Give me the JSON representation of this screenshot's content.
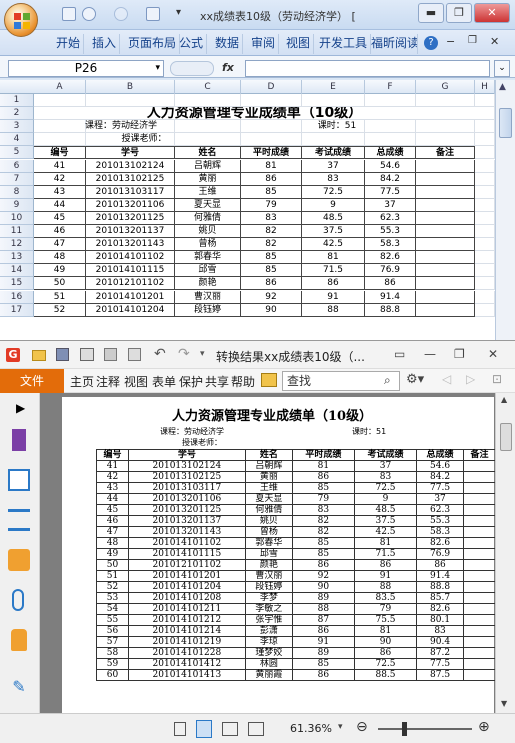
{
  "excel": {
    "title": "xx成绩表10级（劳动经济学）  [",
    "window_buttons": [
      "▬",
      "❐",
      "✕"
    ],
    "ribbon_tabs": [
      "开始",
      "插入",
      "页面布局",
      "公式",
      "数据",
      "审阅",
      "视图",
      "开发工具",
      "福昕阅读器"
    ],
    "name_box": "P26",
    "fx_label": "fx",
    "columns": [
      "A",
      "B",
      "C",
      "D",
      "E",
      "F",
      "G",
      "H"
    ],
    "sheet": {
      "title": "人力资源管理专业成绩单（10级）",
      "course_label": "课程：劳动经济学",
      "hours_label": "课时：51",
      "teacher_label": "授课老师：",
      "headers": [
        "编号",
        "学号",
        "姓名",
        "平时成绩",
        "考试成绩",
        "总成绩",
        "备注"
      ],
      "rows": [
        [
          "41",
          "201013102124",
          "吕朝辉",
          "81",
          "37",
          "54.6"
        ],
        [
          "42",
          "201013102125",
          "黄丽",
          "86",
          "83",
          "84.2"
        ],
        [
          "43",
          "201013103117",
          "王维",
          "85",
          "72.5",
          "77.5"
        ],
        [
          "44",
          "201013201106",
          "夏天显",
          "79",
          "9",
          "37"
        ],
        [
          "45",
          "201013201125",
          "何雅倩",
          "83",
          "48.5",
          "62.3"
        ],
        [
          "46",
          "201013201137",
          "姚贝",
          "82",
          "37.5",
          "55.3"
        ],
        [
          "47",
          "201013201143",
          "曾杨",
          "82",
          "42.5",
          "58.3"
        ],
        [
          "48",
          "201014101102",
          "郭春华",
          "85",
          "81",
          "82.6"
        ],
        [
          "49",
          "201014101115",
          "邱雪",
          "85",
          "71.5",
          "76.9"
        ],
        [
          "50",
          "201012101102",
          "颜艳",
          "86",
          "86",
          "86"
        ],
        [
          "51",
          "201014101201",
          "曹汉丽",
          "92",
          "91",
          "91.4"
        ],
        [
          "52",
          "201014101204",
          "段钰婷",
          "90",
          "88",
          "88.8"
        ]
      ],
      "row_numbers": [
        "1",
        "2",
        "3",
        "4",
        "5",
        "6",
        "7",
        "8",
        "9",
        "10",
        "11",
        "12",
        "13",
        "14",
        "15",
        "16",
        "17"
      ]
    }
  },
  "pdf": {
    "title": "转换结果xx成绩表10级（...",
    "window_buttons": [
      "▭",
      "—",
      "❐",
      "✕"
    ],
    "file_tab": "文件",
    "menus": [
      "主页",
      "注释",
      "视图",
      "表单",
      "保护",
      "共享",
      "帮助"
    ],
    "search_placeholder": "查找",
    "zoom": "61.36%",
    "doc": {
      "title": "人力资源管理专业成绩单（10级）",
      "course_label": "课程：劳动经济学",
      "hours_label": "课时：51",
      "teacher_label": "授课老师：",
      "headers": [
        "编号",
        "学号",
        "姓名",
        "平时成绩",
        "考试成绩",
        "总成绩",
        "备注"
      ],
      "rows": [
        [
          "41",
          "201013102124",
          "吕朝辉",
          "81",
          "37",
          "54.6"
        ],
        [
          "42",
          "201013102125",
          "黄丽",
          "86",
          "83",
          "84.2"
        ],
        [
          "43",
          "201013103117",
          "王维",
          "85",
          "72.5",
          "77.5"
        ],
        [
          "44",
          "201013201106",
          "夏天显",
          "79",
          "9",
          "37"
        ],
        [
          "45",
          "201013201125",
          "何雅倩",
          "83",
          "48.5",
          "62.3"
        ],
        [
          "46",
          "201013201137",
          "姚贝",
          "82",
          "37.5",
          "55.3"
        ],
        [
          "47",
          "201013201143",
          "曾杨",
          "82",
          "42.5",
          "58.3"
        ],
        [
          "48",
          "201014101102",
          "郭春华",
          "85",
          "81",
          "82.6"
        ],
        [
          "49",
          "201014101115",
          "邱雪",
          "85",
          "71.5",
          "76.9"
        ],
        [
          "50",
          "201012101102",
          "颜艳",
          "86",
          "86",
          "86"
        ],
        [
          "51",
          "201014101201",
          "曹汉丽",
          "92",
          "91",
          "91.4"
        ],
        [
          "52",
          "201014101204",
          "段钰婷",
          "90",
          "88",
          "88.8"
        ],
        [
          "53",
          "201014101208",
          "李梦",
          "89",
          "83.5",
          "85.7"
        ],
        [
          "54",
          "201014101211",
          "李敏之",
          "88",
          "79",
          "82.6"
        ],
        [
          "55",
          "201014101212",
          "张宇惟",
          "87",
          "75.5",
          "80.1"
        ],
        [
          "56",
          "201014101214",
          "彭潇",
          "86",
          "81",
          "83"
        ],
        [
          "57",
          "201014101219",
          "李琼",
          "91",
          "90",
          "90.4"
        ],
        [
          "58",
          "201014101228",
          "瑾梦姣",
          "89",
          "86",
          "87.2"
        ],
        [
          "59",
          "201014101412",
          "林圆",
          "85",
          "72.5",
          "77.5"
        ],
        [
          "60",
          "201014101413",
          "黄丽霞",
          "86",
          "88.5",
          "87.5"
        ]
      ]
    }
  }
}
